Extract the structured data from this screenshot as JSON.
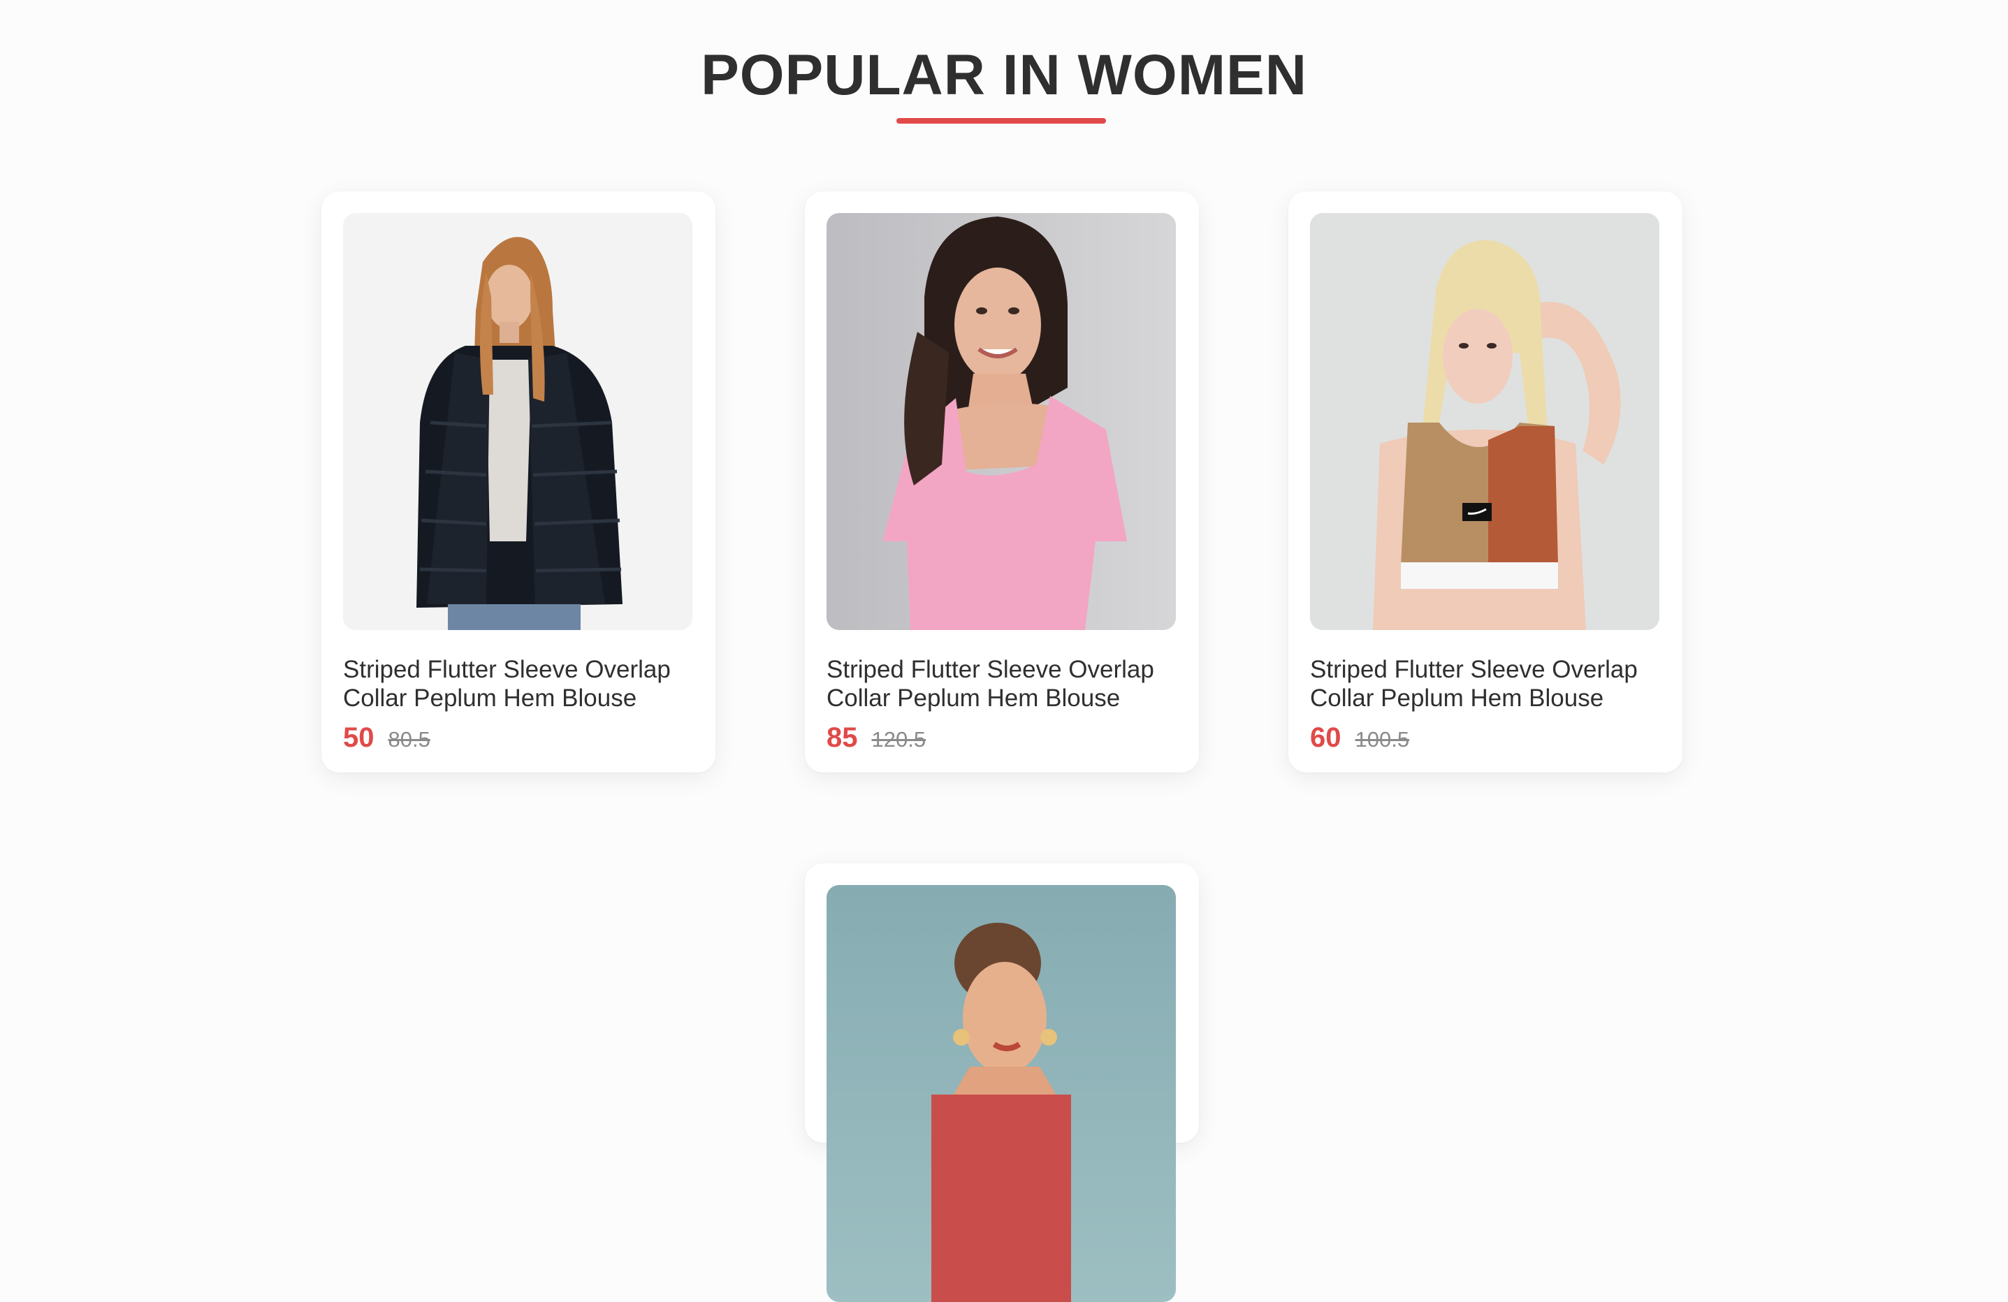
{
  "section": {
    "title": "POPULAR IN WOMEN",
    "accent_color": "#e04a48"
  },
  "products": [
    {
      "name": "Striped Flutter Sleeve Overlap Collar Peplum Hem Blouse",
      "new_price": "50",
      "old_price": "80.5",
      "image": "woman-black-fur-puffer-jacket"
    },
    {
      "name": "Striped Flutter Sleeve Overlap Collar Peplum Hem Blouse",
      "new_price": "85",
      "old_price": "120.5",
      "image": "woman-pink-square-neck-top"
    },
    {
      "name": "Striped Flutter Sleeve Overlap Collar Peplum Hem Blouse",
      "new_price": "60",
      "old_price": "100.5",
      "image": "woman-tan-sports-crop-top"
    },
    {
      "image": "woman-teal-background-portrait"
    }
  ]
}
